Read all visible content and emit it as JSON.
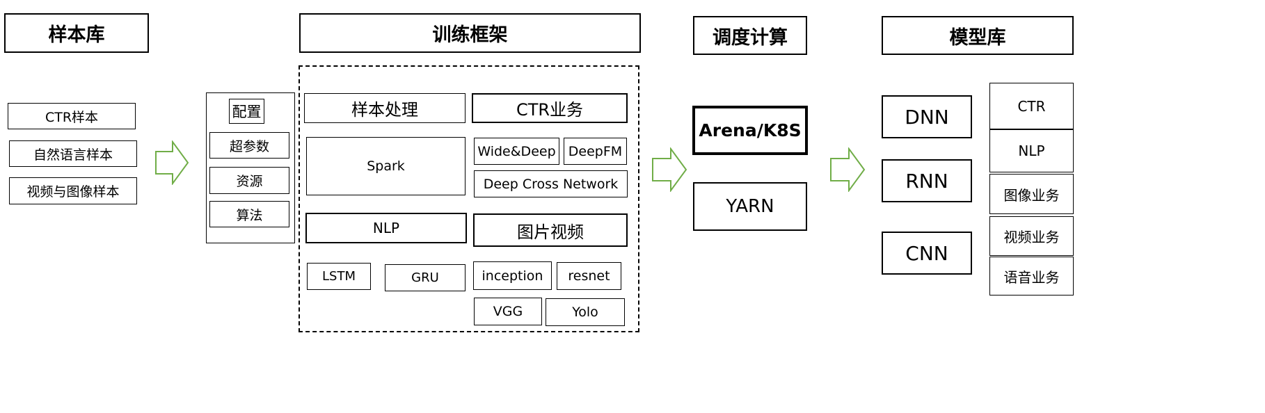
{
  "headers": {
    "sample_lib": "样本库",
    "training": "训练框架",
    "scheduling": "调度计算",
    "model_lib": "模型库"
  },
  "samples": [
    "CTR样本",
    "自然语言样本",
    "视频与图像样本"
  ],
  "config": {
    "title": "配置",
    "items": [
      "超参数",
      "资源",
      "算法"
    ]
  },
  "framework": {
    "sample_processing": "样本处理",
    "spark": "Spark",
    "nlp": "NLP",
    "lstm": "LSTM",
    "gru": "GRU",
    "ctr_business": "CTR业务",
    "wide_deep": "Wide&Deep",
    "deepfm": "DeepFM",
    "deep_cross": "Deep Cross Network",
    "image_video": "图片视频",
    "inception": "inception",
    "resnet": "resnet",
    "vgg": "VGG",
    "yolo": "Yolo"
  },
  "scheduler": {
    "arena": "Arena/K8S",
    "yarn": "YARN"
  },
  "models": [
    "DNN",
    "RNN",
    "CNN"
  ],
  "business": [
    "CTR",
    "NLP",
    "图像业务",
    "视频业务",
    "语音业务"
  ],
  "colors": {
    "arrow": "#70AD47",
    "border": "#000000"
  },
  "icons": [
    "right-arrow-icon"
  ]
}
